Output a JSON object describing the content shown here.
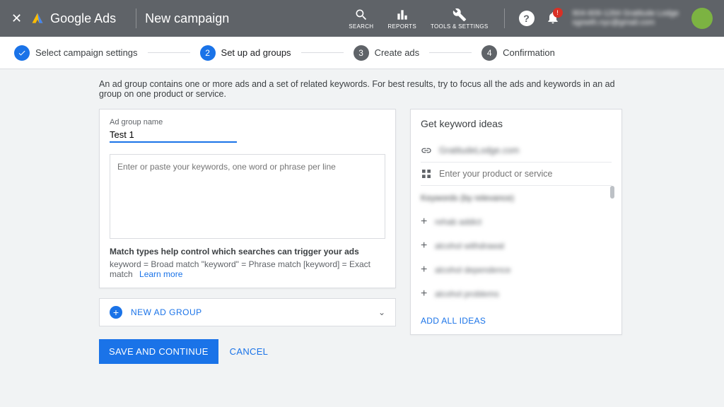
{
  "header": {
    "brand": "Google Ads",
    "page_title": "New campaign",
    "tools": {
      "search": "SEARCH",
      "reports": "REPORTS",
      "settings": "TOOLS & SETTINGS"
    },
    "account_line1": "904-609-1264 Gratitude Lodge",
    "account_line2": "sgowth.nyc@gmail.com"
  },
  "stepper": {
    "step1": "Select campaign settings",
    "step2": "Set up ad groups",
    "step3": "Create ads",
    "step4": "Confirmation",
    "n2": "2",
    "n3": "3",
    "n4": "4"
  },
  "main": {
    "intro": "An ad group contains one or more ads and a set of related keywords. For best results, try to focus all the ads and keywords in an ad group on one product or service.",
    "ad_group_label": "Ad group name",
    "ad_group_value": "Test 1",
    "keywords_placeholder": "Enter or paste your keywords, one word or phrase per line",
    "match_title": "Match types help control which searches can trigger your ads",
    "match_body": "keyword = Broad match   \"keyword\" = Phrase match   [keyword] = Exact match",
    "learn_more": "Learn more",
    "new_ad_group": "NEW AD GROUP"
  },
  "sidebar": {
    "title": "Get keyword ideas",
    "url_value": "GratitudeLodge.com",
    "product_placeholder": "Enter your product or service",
    "kw_header": "Keywords (by relevance)",
    "suggestions": [
      "rehab addict",
      "alcohol withdrawal",
      "alcohol dependence",
      "alcohol problems"
    ],
    "add_all": "ADD ALL IDEAS"
  },
  "actions": {
    "save": "SAVE AND CONTINUE",
    "cancel": "CANCEL"
  }
}
